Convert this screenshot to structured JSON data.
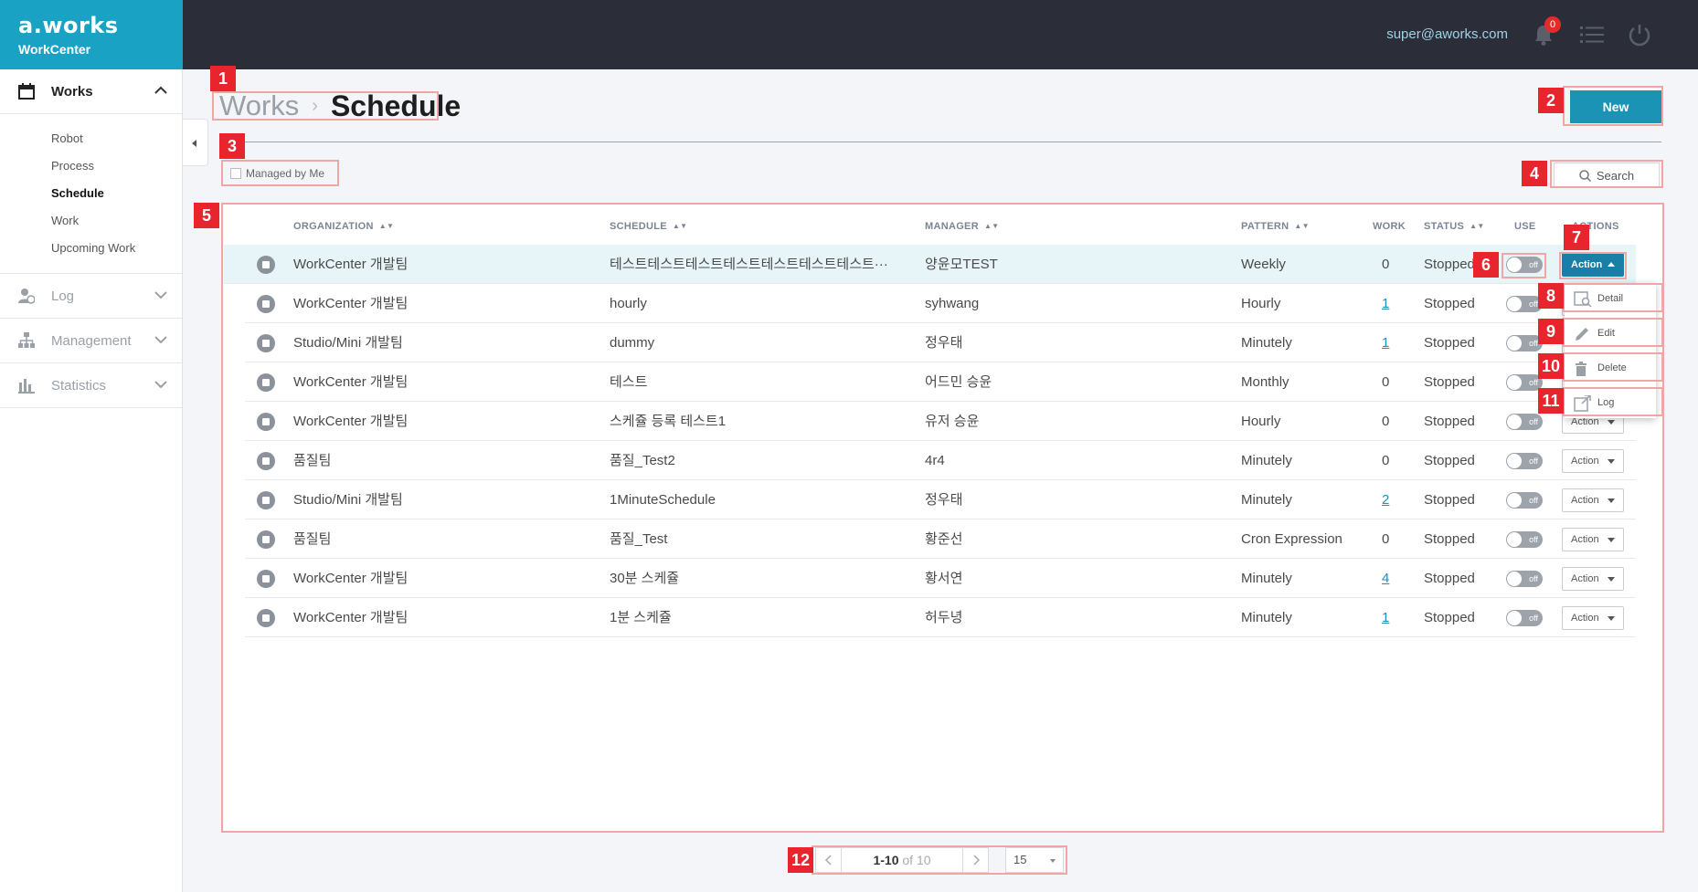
{
  "header": {
    "brand_logo": "a.works",
    "brand_sub": "WorkCenter",
    "user_email": "super@aworks.com",
    "notification_count": "0"
  },
  "sidebar": {
    "works_label": "Works",
    "works_items": [
      "Robot",
      "Process",
      "Schedule",
      "Work",
      "Upcoming Work"
    ],
    "log_label": "Log",
    "management_label": "Management",
    "statistics_label": "Statistics"
  },
  "page": {
    "breadcrumb_parent": "Works",
    "breadcrumb_sep": "›",
    "title": "Schedule",
    "new_label": "New",
    "managed_label": "Managed by Me",
    "search_label": "Search"
  },
  "table": {
    "headers": {
      "organization": "ORGANIZATION",
      "schedule": "SCHEDULE",
      "manager": "MANAGER",
      "pattern": "PATTERN",
      "work": "WORK",
      "status": "STATUS",
      "use": "USE",
      "actions": "ACTIONS"
    },
    "rows": [
      {
        "org": "WorkCenter 개발팀",
        "schedule": "테스트테스트테스트테스트테스트테스트테스트···",
        "manager": "양윤모TEST",
        "pattern": "Weekly",
        "work": "0",
        "status": "Stopped",
        "use": "off",
        "action": "Action"
      },
      {
        "org": "WorkCenter 개발팀",
        "schedule": "hourly",
        "manager": "syhwang",
        "pattern": "Hourly",
        "work": "1",
        "status": "Stopped",
        "use": "off",
        "action": "Action"
      },
      {
        "org": "Studio/Mini 개발팀",
        "schedule": "dummy",
        "manager": "정우태",
        "pattern": "Minutely",
        "work": "1",
        "status": "Stopped",
        "use": "off",
        "action": "Action"
      },
      {
        "org": "WorkCenter 개발팀",
        "schedule": "테스트",
        "manager": "어드민 승윤",
        "pattern": "Monthly",
        "work": "0",
        "status": "Stopped",
        "use": "off",
        "action": "Action"
      },
      {
        "org": "WorkCenter 개발팀",
        "schedule": "스케쥴 등록 테스트1",
        "manager": "유저 승윤",
        "pattern": "Hourly",
        "work": "0",
        "status": "Stopped",
        "use": "off",
        "action": "Action"
      },
      {
        "org": "품질팀",
        "schedule": "품질_Test2",
        "manager": "4r4",
        "pattern": "Minutely",
        "work": "0",
        "status": "Stopped",
        "use": "off",
        "action": "Action"
      },
      {
        "org": "Studio/Mini 개발팀",
        "schedule": "1MinuteSchedule",
        "manager": "정우태",
        "pattern": "Minutely",
        "work": "2",
        "status": "Stopped",
        "use": "off",
        "action": "Action"
      },
      {
        "org": "품질팀",
        "schedule": "품질_Test",
        "manager": "황준선",
        "pattern": "Cron Expression",
        "work": "0",
        "status": "Stopped",
        "use": "off",
        "action": "Action"
      },
      {
        "org": "WorkCenter 개발팀",
        "schedule": "30분 스케쥴",
        "manager": "황서연",
        "pattern": "Minutely",
        "work": "4",
        "status": "Stopped",
        "use": "off",
        "action": "Action"
      },
      {
        "org": "WorkCenter 개발팀",
        "schedule": "1분 스케쥴",
        "manager": "허두녕",
        "pattern": "Minutely",
        "work": "1",
        "status": "Stopped",
        "use": "off",
        "action": "Action"
      }
    ]
  },
  "action_menu": {
    "detail": "Detail",
    "edit": "Edit",
    "delete": "Delete",
    "log": "Log"
  },
  "pagination": {
    "range": "1-10",
    "of_label": "of",
    "total": "10",
    "page_size": "15"
  },
  "markers": [
    "1",
    "2",
    "3",
    "4",
    "5",
    "6",
    "7",
    "8",
    "9",
    "10",
    "11",
    "12"
  ],
  "colors": {
    "brand": "#1aa2c4",
    "topbar": "#2b2e38",
    "primary_button": "#1a93b5",
    "marker": "#e8242c",
    "toggle_off": "#9ca3ab"
  }
}
